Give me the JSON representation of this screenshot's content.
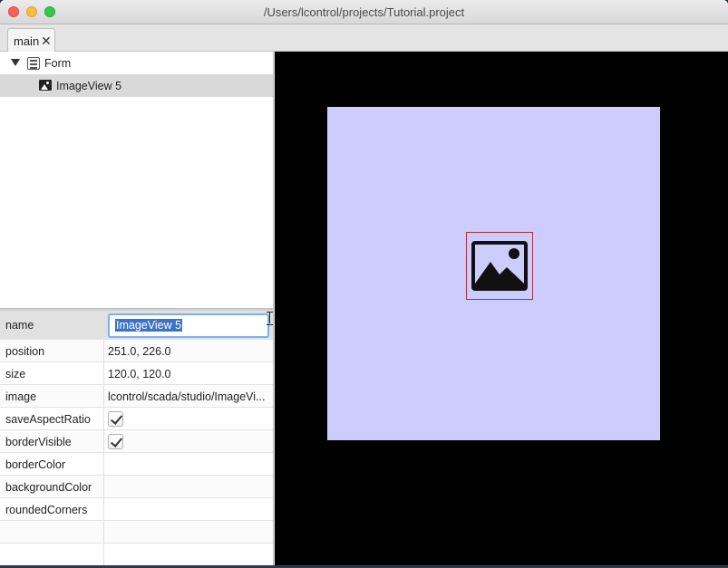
{
  "window": {
    "title": "/Users/lcontrol/projects/Tutorial.project"
  },
  "tabs": [
    {
      "label": "main",
      "close_glyph": "✕"
    }
  ],
  "tree": {
    "root": {
      "label": "Form",
      "icon": "form-icon"
    },
    "children": [
      {
        "label": "ImageView 5",
        "icon": "image-icon",
        "selected": true
      }
    ]
  },
  "properties": {
    "name": {
      "key": "name",
      "value": "ImageView 5"
    },
    "rows": [
      {
        "key": "position",
        "value": "251.0, 226.0"
      },
      {
        "key": "size",
        "value": "120.0, 120.0"
      },
      {
        "key": "image",
        "value": "lcontrol/scada/studio/ImageVi..."
      },
      {
        "key": "saveAspectRatio",
        "checked": true
      },
      {
        "key": "borderVisible",
        "checked": true
      },
      {
        "key": "borderColor",
        "value": ""
      },
      {
        "key": "backgroundColor",
        "value": ""
      },
      {
        "key": "roundedCorners",
        "value": ""
      }
    ]
  },
  "canvas": {
    "background": "#000000",
    "form_background": "#ccccff",
    "selection_border": "#b0303a",
    "element_icon": "image-placeholder-icon"
  }
}
